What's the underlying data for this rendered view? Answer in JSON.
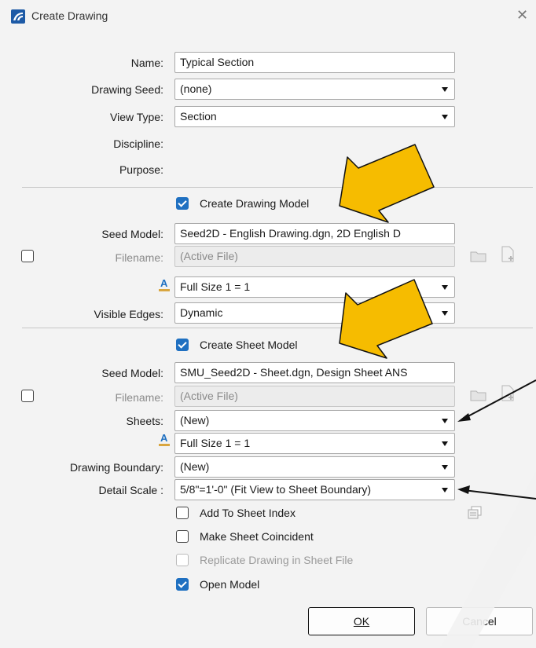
{
  "title": "Create Drawing",
  "fields": {
    "name_label": "Name:",
    "name_value": "Typical Section",
    "drawing_seed_label": "Drawing Seed:",
    "drawing_seed_value": "(none)",
    "view_type_label": "View Type:",
    "view_type_value": "Section",
    "discipline_label": "Discipline:",
    "purpose_label": "Purpose:"
  },
  "drawing_model": {
    "create_label": "Create Drawing Model",
    "create_checked": true,
    "seed_label": "Seed Model:",
    "seed_value": "Seed2D - English Drawing.dgn, 2D English D",
    "filename_label": "Filename:",
    "filename_value": "(Active File)",
    "annotation_scale_value": "Full Size 1 = 1",
    "visible_edges_label": "Visible Edges:",
    "visible_edges_value": "Dynamic"
  },
  "sheet_model": {
    "create_label": "Create Sheet Model",
    "create_checked": true,
    "seed_label": "Seed Model:",
    "seed_value": "SMU_Seed2D - Sheet.dgn, Design Sheet ANS",
    "filename_label": "Filename:",
    "filename_value": "(Active File)",
    "sheets_label": "Sheets:",
    "sheets_value": "(New)",
    "annotation_scale_value": "Full Size 1 = 1",
    "boundary_label": "Drawing Boundary:",
    "boundary_value": "(New)",
    "detail_scale_label": "Detail Scale :",
    "detail_scale_value": "5/8\"=1'-0\" (Fit View to Sheet Boundary)"
  },
  "options": {
    "add_to_index": "Add To Sheet Index",
    "make_coincident": "Make Sheet Coincident",
    "replicate_drawing": "Replicate Drawing in Sheet File",
    "open_model": "Open Model"
  },
  "buttons": {
    "ok": "OK",
    "cancel": "Cancel"
  },
  "colors": {
    "accent": "#1f70c1",
    "callout_arrow": "#f6bc00"
  },
  "icons": [
    "app-logo-icon",
    "close-icon",
    "annotation-scale-icon",
    "folder-icon",
    "new-file-icon",
    "sheet-index-icon"
  ]
}
